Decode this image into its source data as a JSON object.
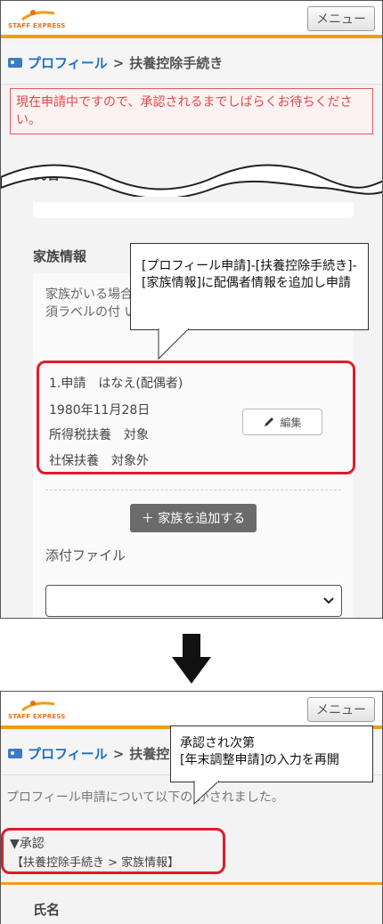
{
  "screen1": {
    "header": {
      "logo_text": "STAFF EXPRESS",
      "menu_label": "メニュー"
    },
    "breadcrumb": {
      "link": "プロフィール",
      "separator": ">",
      "current": "扶養控除手続き"
    },
    "alert_text": "現在申請中ですので、承認されるまでしばらくお待ちください。",
    "name_label": "氏名",
    "family_section_label": "家族情報",
    "family_note": "家族がいる場合 必須ラベルの付 い",
    "callout_text": "[プロフィール申請]-[扶養控除手続き]-[家族情報]に配偶者情報を追加し申請",
    "member": {
      "status_name": "1.申請　はなえ(配偶者)",
      "birthday": "1980年11月28日",
      "income_tax": "所得税扶養　対象",
      "social_insurance": "社保扶養　対象外"
    },
    "edit_label": "編集",
    "add_family_label": "＋ 家族を追加する",
    "attachment_label": "添付ファイル",
    "attachment_select_value": ""
  },
  "screen2": {
    "header": {
      "logo_text": "STAFF EXPRESS",
      "menu_label": "メニュー"
    },
    "breadcrumb": {
      "link": "プロフィール",
      "separator": ">",
      "current": "扶養控除"
    },
    "callout_text": "承認され次第\n[年末調整申請]の入力を再開",
    "message": "プロフィール申請について以下の  がされました。",
    "approved_title": "▼承認",
    "approved_detail": "【扶養控除手続き > 家族情報】",
    "name_label": "氏名"
  },
  "colors": {
    "accent_orange": "#f39c12",
    "highlight_red": "#e11b2d",
    "link_blue": "#1f6fbf",
    "alert_red": "#e04848"
  }
}
